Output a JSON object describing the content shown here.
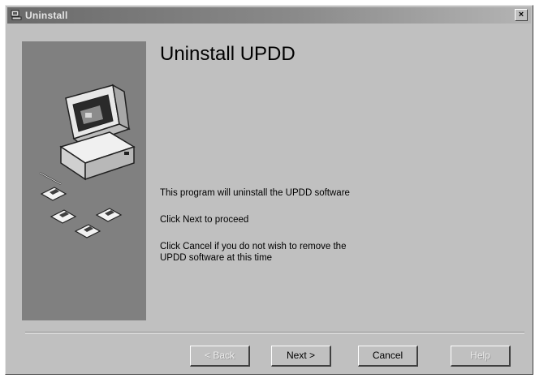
{
  "window": {
    "title": "Uninstall",
    "close_label": "×"
  },
  "main": {
    "heading": "Uninstall UPDD",
    "line1": "This program will uninstall the UPDD software",
    "line2": "Click Next to proceed",
    "line3a": "Click Cancel if you do not wish to remove the",
    "line3b": "UPDD software at this time"
  },
  "buttons": {
    "back": "< Back",
    "next": "Next >",
    "cancel": "Cancel",
    "help": "Help"
  },
  "colors": {
    "face": "#c0c0c0",
    "panel": "#808080",
    "titlebar": "#6a6a6a"
  },
  "icons": [
    "uninstall-icon",
    "close-icon",
    "computer-icon",
    "floppy-disk-icon"
  ]
}
